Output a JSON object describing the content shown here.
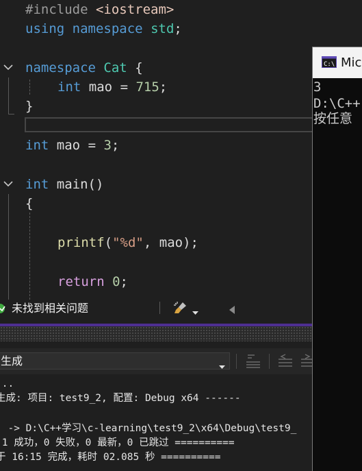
{
  "editor": {
    "lines": {
      "l1": {
        "directive": "#include",
        "header": "<iostream>"
      },
      "l2": {
        "using": "using",
        "namespace": "namespace",
        "std": "std",
        "semi": ";"
      },
      "l4": {
        "namespace": "namespace",
        "name": "Cat",
        "brace": "{"
      },
      "l5": {
        "type": "int",
        "var": "mao",
        "eq": "=",
        "value": "715",
        "semi": ";"
      },
      "l6": {
        "brace": "}"
      },
      "l8": {
        "type": "int",
        "var": "mao",
        "eq": "=",
        "value": "3",
        "semi": ";"
      },
      "l10": {
        "type": "int",
        "fn": "main",
        "parens": "()"
      },
      "l11": {
        "brace": "{"
      },
      "l13": {
        "fn": "printf",
        "open": "(",
        "str": "\"%d\"",
        "comma": ",",
        "arg": "mao",
        "close": ");"
      },
      "l15": {
        "kw": "return",
        "value": "0",
        "semi": ";"
      }
    },
    "fold_icons": [
      "chevron-down-icon",
      "chevron-down-icon"
    ]
  },
  "status": {
    "issues_text": "未找到相关问题",
    "issues_icon": "check-circle-icon",
    "cleanup_icon": "brush-icon"
  },
  "output": {
    "source_value": "生成",
    "lines": [
      "...",
      "生成: 项目: test9_2, 配置: Debug x64 ------",
      "",
      "j -> D:\\C++学习\\c-learning\\test9_2\\x64\\Debug\\test9_",
      " 1 成功，0 失败，0 最新，0 已跳过 ==========",
      "于 16:15 完成，耗时 02.085 秒 =========="
    ]
  },
  "console": {
    "title": "Micro",
    "lines": [
      "3",
      "D:\\C++",
      "按任意"
    ]
  },
  "colors": {
    "editor_bg": "#1f1f1f",
    "keyword": "#569cd6",
    "accent": "#4e2f91",
    "console_bg": "#0c0c0c"
  }
}
